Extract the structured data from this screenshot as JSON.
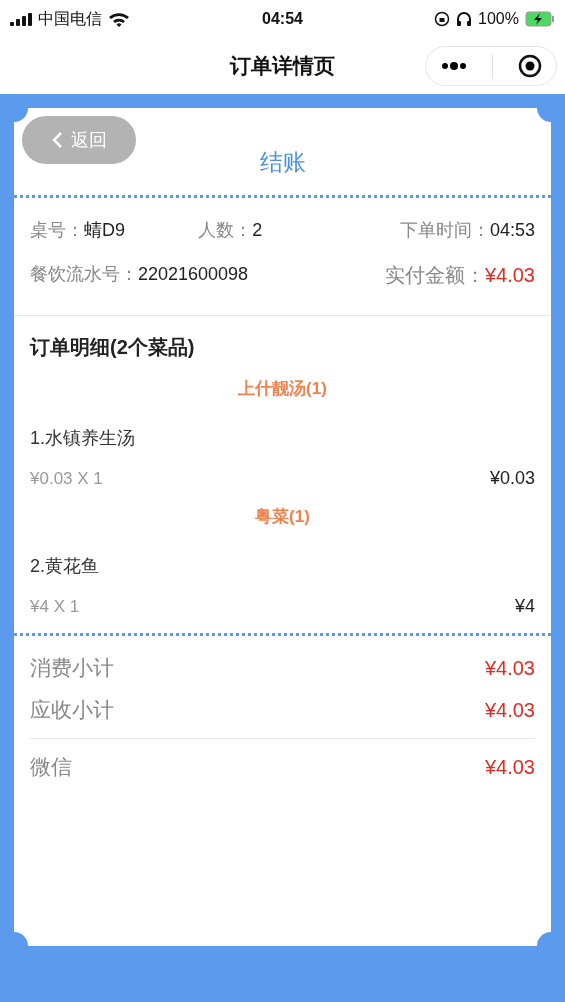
{
  "status_bar": {
    "carrier": "中国电信",
    "time": "04:54",
    "battery": "100%"
  },
  "nav": {
    "title": "订单详情页"
  },
  "card": {
    "back_button": "返回",
    "title": "结账",
    "info": [
      {
        "label": "桌号：",
        "value": "蜻D9",
        "kind": "plain"
      },
      {
        "label": "人数：",
        "value": "2",
        "kind": "plain"
      },
      {
        "label": "下单时间：",
        "value": "04:53",
        "kind": "plain"
      },
      {
        "label": "餐饮流水号：",
        "value": "22021600098",
        "kind": "plain"
      },
      {
        "label": "实付金额：",
        "value": "¥4.03",
        "kind": "amount"
      }
    ],
    "details_title": "订单明细(2个菜品)",
    "groups": [
      {
        "name": "上什靓汤(1)",
        "items": [
          {
            "name": "1.水镇养生汤",
            "unit": "¥0.03 X 1",
            "total": "¥0.03"
          }
        ]
      },
      {
        "name": "粤菜(1)",
        "items": [
          {
            "name": "2.黄花鱼",
            "unit": "¥4 X 1",
            "total": "¥4"
          }
        ]
      }
    ],
    "summary": [
      {
        "label": "消费小计",
        "value": "¥4.03"
      },
      {
        "label": "应收小计",
        "value": "¥4.03"
      }
    ],
    "payments": [
      {
        "label": "微信",
        "value": "¥4.03"
      }
    ]
  }
}
